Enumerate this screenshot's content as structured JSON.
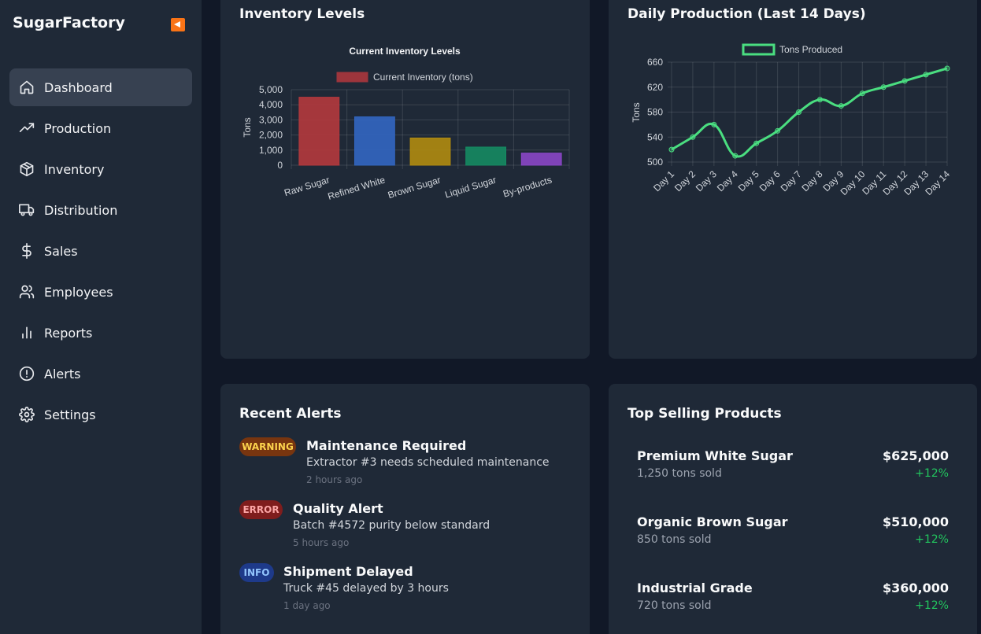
{
  "app": {
    "brand": "SugarFactory",
    "accent": "#f97316"
  },
  "sidebar": {
    "items": [
      {
        "label": "Dashboard",
        "icon": "home-icon",
        "active": true
      },
      {
        "label": "Production",
        "icon": "trending-up-icon"
      },
      {
        "label": "Inventory",
        "icon": "package-icon"
      },
      {
        "label": "Distribution",
        "icon": "truck-icon"
      },
      {
        "label": "Sales",
        "icon": "dollar-icon"
      },
      {
        "label": "Employees",
        "icon": "users-icon"
      },
      {
        "label": "Reports",
        "icon": "bar-chart-icon"
      },
      {
        "label": "Alerts",
        "icon": "alert-circle-icon"
      },
      {
        "label": "Settings",
        "icon": "gear-icon"
      }
    ]
  },
  "inventory": {
    "title": "Inventory Levels",
    "chart_data": {
      "type": "bar",
      "title": "Current Inventory Levels",
      "ylabel": "Tons",
      "xlabel": "",
      "categories": [
        "Raw Sugar",
        "Refined White",
        "Brown Sugar",
        "Liquid Sugar",
        "By-products"
      ],
      "series": [
        {
          "name": "Current Inventory (tons)",
          "values": [
            4500,
            3200,
            1800,
            1200,
            800
          ]
        }
      ],
      "colors": [
        "#b4383d",
        "#3266c2",
        "#b08b10",
        "#158a62",
        "#8a46c6"
      ],
      "ylim": [
        0,
        5000
      ],
      "yticks": [
        "5,000",
        "4,000",
        "3,000",
        "2,000",
        "1,000",
        "0"
      ],
      "grid": true,
      "legend": "top"
    }
  },
  "production": {
    "title": "Daily Production (Last 14 Days)",
    "chart_data": {
      "type": "line",
      "ylabel": "Tons",
      "x": [
        "Day 1",
        "Day 2",
        "Day 3",
        "Day 4",
        "Day 5",
        "Day 6",
        "Day 7",
        "Day 8",
        "Day 9",
        "Day 10",
        "Day 11",
        "Day 12",
        "Day 13",
        "Day 14"
      ],
      "series": [
        {
          "name": "Tons Produced",
          "values": [
            520,
            540,
            560,
            510,
            530,
            550,
            580,
            600,
            590,
            610,
            620,
            630,
            640,
            650
          ]
        }
      ],
      "color": "#4ade80",
      "ylim": [
        500,
        660
      ],
      "yticks": [
        "660",
        "620",
        "580",
        "540",
        "500"
      ],
      "grid": true,
      "legend": "top"
    }
  },
  "alerts": {
    "title": "Recent Alerts",
    "items": [
      {
        "badge": "WARNING",
        "title": "Maintenance Required",
        "desc": "Extractor #3 needs scheduled maintenance",
        "time": "2 hours ago",
        "badge_bg": "#78350f",
        "badge_fg": "#fcd34d"
      },
      {
        "badge": "ERROR",
        "title": "Quality Alert",
        "desc": "Batch #4572 purity below standard",
        "time": "5 hours ago",
        "badge_bg": "#7f1d1d",
        "badge_fg": "#fca5a5"
      },
      {
        "badge": "INFO",
        "title": "Shipment Delayed",
        "desc": "Truck #45 delayed by 3 hours",
        "time": "1 day ago",
        "badge_bg": "#1e3a8a",
        "badge_fg": "#93c5fd"
      }
    ]
  },
  "top_products": {
    "title": "Top Selling Products",
    "items": [
      {
        "name": "Premium White Sugar",
        "sub": "1,250 tons sold",
        "revenue": "$625,000",
        "change": "+12%"
      },
      {
        "name": "Organic Brown Sugar",
        "sub": "850 tons sold",
        "revenue": "$510,000",
        "change": "+12%"
      },
      {
        "name": "Industrial Grade",
        "sub": "720 tons sold",
        "revenue": "$360,000",
        "change": "+12%"
      }
    ]
  }
}
